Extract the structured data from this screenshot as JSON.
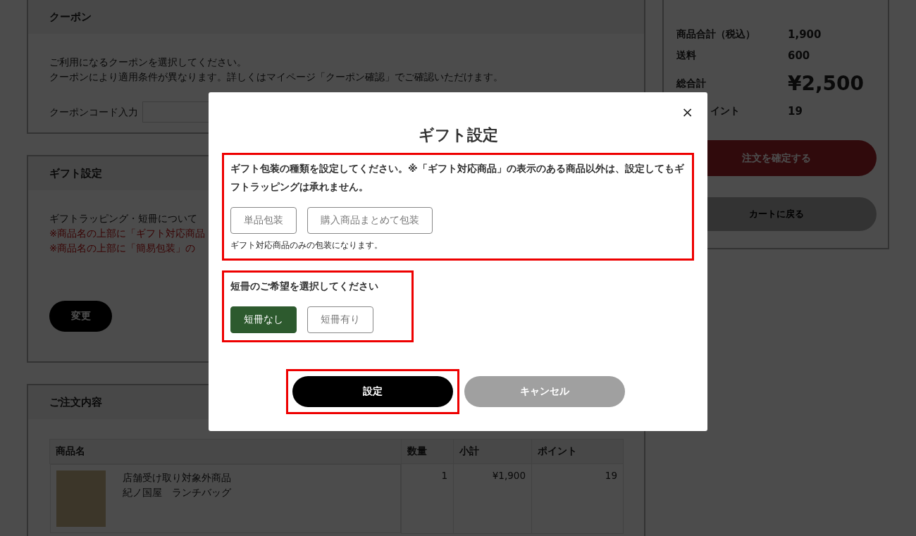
{
  "coupon": {
    "title": "クーポン",
    "lines": [
      "ご利用になるクーポンを選択してください。",
      "クーポンにより適用条件が異なります。詳しくはマイページ「クーポン確認」でご確認いただけます。"
    ],
    "code_label": "クーポンコード入力"
  },
  "gift_section": {
    "title": "ギフト設定",
    "intro": "ギフトラッピング・短冊について",
    "notes": [
      "※商品名の上部に「ギフト対応商品",
      "※商品名の上部に「簡易包装」の"
    ],
    "button": "変更"
  },
  "order": {
    "title": "ご注文内容",
    "columns": [
      "商品名",
      "数量",
      "小計",
      "ポイント"
    ],
    "rows": [
      {
        "lines": [
          "店舗受け取り対象外商品",
          "紀ノ国屋　ランチバッグ"
        ],
        "quantity": "1",
        "subtotal": "¥1,900",
        "points": "19"
      }
    ]
  },
  "summary": {
    "rows": [
      {
        "kind": "normal",
        "label": "商品合計（税込）",
        "value": "1,900"
      },
      {
        "kind": "normal",
        "label": "送料",
        "value": "600"
      },
      {
        "kind": "total",
        "label": "総合計",
        "value": "¥2,500"
      },
      {
        "kind": "covered",
        "label": "イント",
        "value": "19"
      }
    ],
    "confirm_button": "注文を確定する",
    "back_button": "カートに戻る"
  },
  "modal": {
    "close": "×",
    "title": "ギフト設定",
    "groups": [
      {
        "highlighted": true,
        "heading": "ギフト包装の種類を設定してください。※「ギフト対応商品」の表示のある商品以外は、設定してもギフトラッピングは承れません。",
        "options": [
          {
            "label": "単品包装",
            "selected": false
          },
          {
            "label": "購入商品まとめて包装",
            "selected": false
          }
        ],
        "note": "ギフト対応商品のみの包装になります。"
      },
      {
        "highlighted": true,
        "heading": "短冊のご希望を選択してください",
        "options": [
          {
            "label": "短冊なし",
            "selected": true
          },
          {
            "label": "短冊有り",
            "selected": false
          }
        ]
      }
    ],
    "submit": {
      "label": "設定",
      "highlighted": true
    },
    "cancel": "キャンセル"
  }
}
